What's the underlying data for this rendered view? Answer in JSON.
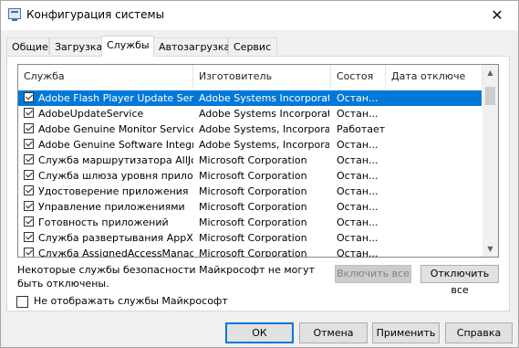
{
  "window": {
    "title": "Конфигурация системы",
    "close_glyph": "✕"
  },
  "tabs": [
    "Общие",
    "Загрузка",
    "Службы",
    "Автозагрузка",
    "Сервис"
  ],
  "active_tab": "Службы",
  "columns": [
    "Служба",
    "Изготовитель",
    "Состоя",
    "Дата отключе"
  ],
  "services": [
    {
      "name": "Adobe Flash Player Update Service",
      "vendor": "Adobe Systems Incorporated",
      "status": "Остан...",
      "checked": true,
      "selected": true
    },
    {
      "name": "AdobeUpdateService",
      "vendor": "Adobe Systems Incorporated",
      "status": "Остан...",
      "checked": true
    },
    {
      "name": "Adobe Genuine Monitor Service",
      "vendor": "Adobe Systems, Incorpora",
      "status": "Работает",
      "checked": true
    },
    {
      "name": "Adobe Genuine Software Integri...",
      "vendor": "Adobe Systems, Incorpora",
      "status": "Остан...",
      "checked": true
    },
    {
      "name": "Служба маршрутизатора AllJoyn",
      "vendor": "Microsoft Corporation",
      "status": "Остан...",
      "checked": true
    },
    {
      "name": "Служба шлюза уровня прилож...",
      "vendor": "Microsoft Corporation",
      "status": "Остан...",
      "checked": true
    },
    {
      "name": "Удостоверение приложения",
      "vendor": "Microsoft Corporation",
      "status": "Остан...",
      "checked": true
    },
    {
      "name": "Управление приложениями",
      "vendor": "Microsoft Corporation",
      "status": "Остан...",
      "checked": true
    },
    {
      "name": "Готовность приложений",
      "vendor": "Microsoft Corporation",
      "status": "Остан...",
      "checked": true
    },
    {
      "name": "Служба развертывания AppX (...",
      "vendor": "Microsoft Corporation",
      "status": "Остан...",
      "checked": true
    },
    {
      "name": "Служба AssignedAccessManager",
      "vendor": "Microsoft Corporation",
      "status": "Остан...",
      "checked": true
    }
  ],
  "note": "Некоторые службы безопасности Майкрософт не могут быть отключены.",
  "buttons": {
    "enable_all": "Включить все",
    "disable_all": "Отключить все"
  },
  "hide_ms_label": "Не отображать службы Майкрософт",
  "footer": {
    "ok": "ОК",
    "cancel": "Отмена",
    "apply": "Применить",
    "help": "Справка"
  },
  "colors": {
    "selection": "#0078d7"
  }
}
